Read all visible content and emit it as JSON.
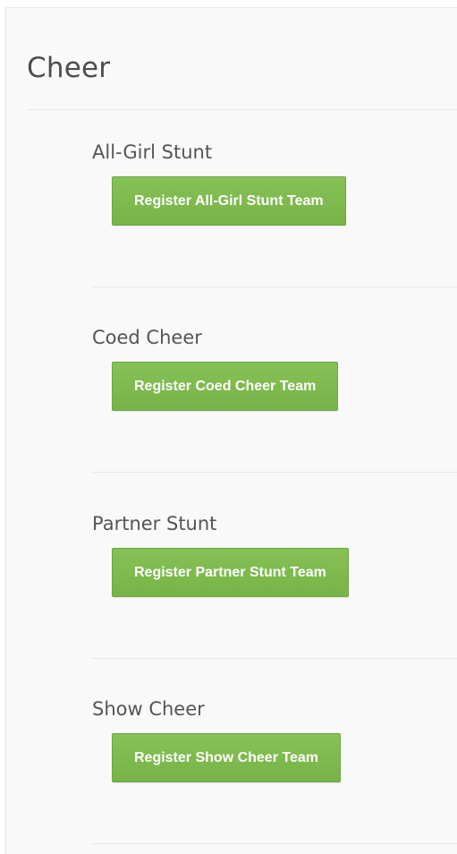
{
  "page": {
    "title": "Cheer"
  },
  "sections": [
    {
      "title": "All-Girl Stunt",
      "button_label": "Register All-Girl Stunt Team"
    },
    {
      "title": "Coed Cheer",
      "button_label": "Register Coed Cheer Team"
    },
    {
      "title": "Partner Stunt",
      "button_label": "Register Partner Stunt Team"
    },
    {
      "title": "Show Cheer",
      "button_label": "Register Show Cheer Team"
    }
  ],
  "colors": {
    "button_green": "#7cb74c",
    "panel_background": "#f9f9f9"
  }
}
